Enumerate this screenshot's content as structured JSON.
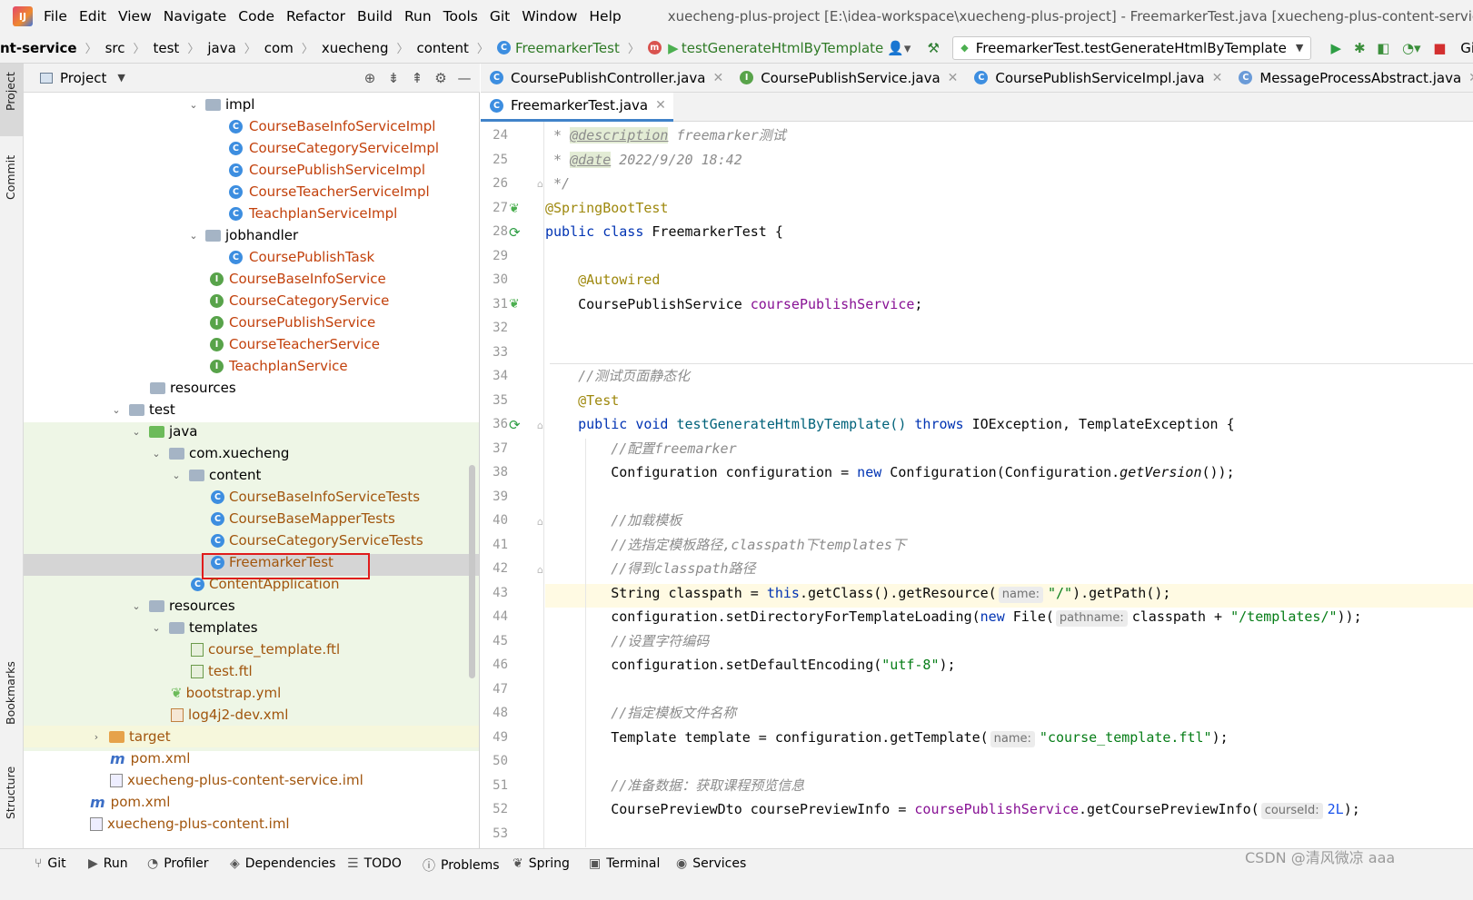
{
  "menubar": {
    "items": [
      "File",
      "Edit",
      "View",
      "Navigate",
      "Code",
      "Refactor",
      "Build",
      "Run",
      "Tools",
      "Git",
      "Window",
      "Help"
    ],
    "title": "xuecheng-plus-project [E:\\idea-workspace\\xuecheng-plus-project] - FreemarkerTest.java [xuecheng-plus-content-service]"
  },
  "navbar": {
    "crumbs": [
      "nt-service",
      "src",
      "test",
      "java",
      "com",
      "xuecheng",
      "content",
      "FreemarkerTest",
      "testGenerateHtmlByTemplate"
    ],
    "run_config": "FreemarkerTest.testGenerateHtmlByTemplate",
    "git_label": "Git:"
  },
  "left_strip": {
    "project": "Project",
    "commit": "Commit",
    "bookmarks": "Bookmarks",
    "structure": "Structure"
  },
  "project_panel": {
    "title": "Project"
  },
  "tree": [
    {
      "label": "impl"
    },
    {
      "label": "CourseBaseInfoServiceImpl"
    },
    {
      "label": "CourseCategoryServiceImpl"
    },
    {
      "label": "CoursePublishServiceImpl"
    },
    {
      "label": "CourseTeacherServiceImpl"
    },
    {
      "label": "TeachplanServiceImpl"
    },
    {
      "label": "jobhandler"
    },
    {
      "label": "CoursePublishTask"
    },
    {
      "label": "CourseBaseInfoService"
    },
    {
      "label": "CourseCategoryService"
    },
    {
      "label": "CoursePublishService"
    },
    {
      "label": "CourseTeacherService"
    },
    {
      "label": "TeachplanService"
    },
    {
      "label": "resources"
    },
    {
      "label": "test"
    },
    {
      "label": "java"
    },
    {
      "label": "com.xuecheng"
    },
    {
      "label": "content"
    },
    {
      "label": "CourseBaseInfoServiceTests"
    },
    {
      "label": "CourseBaseMapperTests"
    },
    {
      "label": "CourseCategoryServiceTests"
    },
    {
      "label": "FreemarkerTest"
    },
    {
      "label": "ContentApplication"
    },
    {
      "label": "resources"
    },
    {
      "label": "templates"
    },
    {
      "label": "course_template.ftl"
    },
    {
      "label": "test.ftl"
    },
    {
      "label": "bootstrap.yml"
    },
    {
      "label": "log4j2-dev.xml"
    },
    {
      "label": "target"
    },
    {
      "label": "pom.xml"
    },
    {
      "label": "xuecheng-plus-content-service.iml"
    },
    {
      "label": "pom.xml"
    },
    {
      "label": "xuecheng-plus-content.iml"
    }
  ],
  "tabs_row1": [
    "CoursePublishController.java",
    "CoursePublishService.java",
    "CoursePublishServiceImpl.java",
    "MessageProcessAbstract.java"
  ],
  "tabs_row2": [
    "FreemarkerTest.java"
  ],
  "editor": {
    "line_numbers": [
      "24",
      "25",
      "26",
      "27",
      "28",
      "29",
      "30",
      "31",
      "32",
      "33",
      "34",
      "35",
      "36",
      "37",
      "38",
      "39",
      "40",
      "41",
      "42",
      "43",
      "44",
      "45",
      "46",
      "47",
      "48",
      "49",
      "50",
      "51",
      "52",
      "53"
    ],
    "code": {
      "l24a": " * ",
      "l24tag": "@description",
      "l24b": " freemarker测试",
      "l25a": " * ",
      "l25tag": "@date",
      "l25b": " 2022/9/20 18:42",
      "l26": " */",
      "l27": "@SpringBootTest",
      "l28a": "public class",
      "l28b": " FreemarkerTest {",
      "l30": "    @Autowired",
      "l31a": "    CoursePublishService ",
      "l31b": "coursePublishService",
      "l31c": ";",
      "l34": "    //测试页面静态化",
      "l35": "    @Test",
      "l36a": "    public void",
      "l36b": " testGenerateHtmlByTemplate() ",
      "l36c": "throws",
      "l36d": " IOException, TemplateException {",
      "l37": "        //配置freemarker",
      "l38a": "        Configuration configuration = ",
      "l38b": "new",
      "l38c": " Configuration(Configuration.",
      "l38d": "getVersion",
      "l38e": "());",
      "l40": "        //加载模板",
      "l41": "        //选指定模板路径,classpath下templates下",
      "l42": "        //得到classpath路径",
      "l43a": "        String classpath = ",
      "l43b": "this",
      "l43c": ".getClass().getResource(",
      "l43hint": "name:",
      "l43d": "\"/\"",
      "l43e": ").getPath();",
      "l44a": "        configuration.setDirectoryForTemplateLoading(",
      "l44b": "new",
      "l44c": " File(",
      "l44hint": "pathname:",
      "l44d": "classpath + ",
      "l44e": "\"/templates/\"",
      "l44f": "));",
      "l45": "        //设置字符编码",
      "l46a": "        configuration.setDefaultEncoding(",
      "l46b": "\"utf-8\"",
      "l46c": ");",
      "l48": "        //指定模板文件名称",
      "l49a": "        Template template = configuration.getTemplate(",
      "l49hint": "name:",
      "l49b": "\"course_template.ftl\"",
      "l49c": ");",
      "l51": "        //准备数据：获取课程预览信息",
      "l52a": "        CoursePreviewDto coursePreviewInfo = ",
      "l52b": "coursePublishService",
      "l52c": ".getCoursePreviewInfo(",
      "l52hint": "courseId:",
      "l52d": "2L",
      "l52e": ");"
    }
  },
  "statusbar": [
    "Git",
    "Run",
    "Profiler",
    "Dependencies",
    "TODO",
    "Problems",
    "Spring",
    "Terminal",
    "Services"
  ],
  "watermark": "CSDN @清风微凉 aaa",
  "colors": {
    "keyword": "#0033b3",
    "annotation": "#9e880d",
    "comment": "#8c8c8c",
    "string": "#067d17",
    "field": "#871094",
    "number": "#1750eb",
    "file_red": "#c2410c",
    "selection_box": "#e01b1b",
    "test_bg": "#eef6e6",
    "caret_line": "#fffae3"
  }
}
